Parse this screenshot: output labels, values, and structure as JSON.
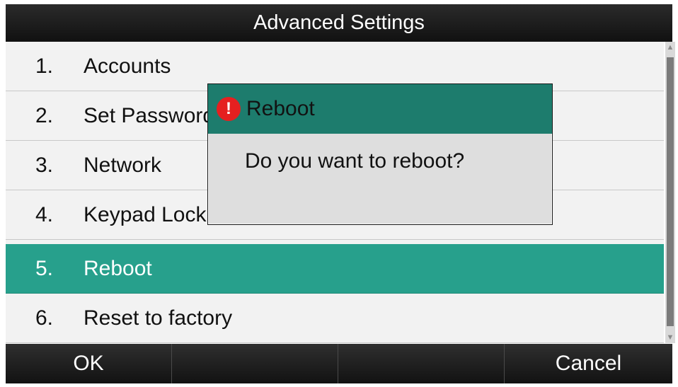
{
  "header": {
    "title": "Advanced Settings"
  },
  "menu": {
    "items": [
      {
        "number": "1.",
        "label": "Accounts"
      },
      {
        "number": "2.",
        "label": "Set Password"
      },
      {
        "number": "3.",
        "label": "Network"
      },
      {
        "number": "4.",
        "label": "Keypad Lock"
      },
      {
        "number": "5.",
        "label": "Reboot",
        "selected": true
      },
      {
        "number": "6.",
        "label": "Reset to factory"
      }
    ]
  },
  "dialog": {
    "title": "Reboot",
    "message": "Do you want to reboot?",
    "icon": "warning-icon",
    "icon_glyph": "!"
  },
  "softkeys": {
    "left": "OK",
    "middle_left": "",
    "middle_right": "",
    "right": "Cancel"
  },
  "scrollbar": {
    "up_glyph": "▲",
    "down_glyph": "▼"
  },
  "colors": {
    "selected_row": "#27a08c",
    "dialog_header": "#1d7c6d",
    "warning": "#e52020"
  }
}
